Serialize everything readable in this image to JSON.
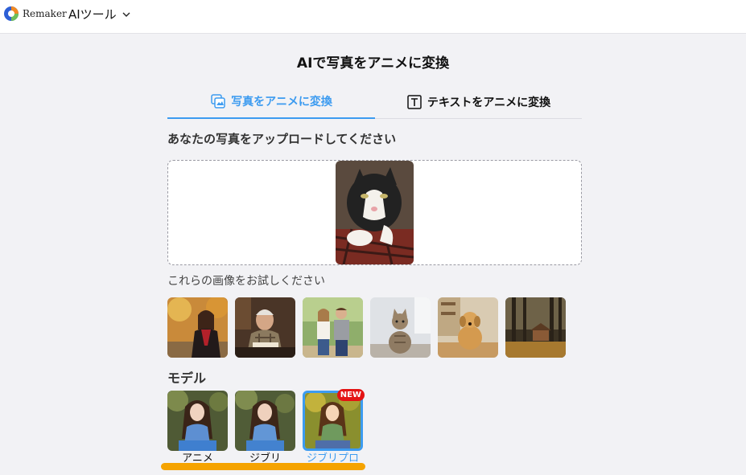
{
  "header": {
    "brand": "Remaker",
    "tools_label": "AIツール"
  },
  "page": {
    "title": "AIで写真をアニメに変換"
  },
  "tabs": [
    {
      "label": "写真をアニメに変換",
      "active": true
    },
    {
      "label": "テキストをアニメに変換",
      "active": false
    }
  ],
  "upload": {
    "heading": "あなたの写真をアップロードしてください"
  },
  "samples": {
    "label": "これらの画像をお試しください",
    "items": [
      "woman-autumn",
      "old-man-reading",
      "couple",
      "cat",
      "dog",
      "forest-cabin"
    ]
  },
  "models": {
    "heading": "モデル",
    "items": [
      {
        "label": "アニメ",
        "selected": false,
        "badge": ""
      },
      {
        "label": "ジブリ",
        "selected": false,
        "badge": ""
      },
      {
        "label": "ジブリプロ",
        "selected": true,
        "badge": "NEW"
      }
    ]
  },
  "colors": {
    "accent": "#3c9bf0",
    "badge": "#e41313",
    "highlight": "#f5a300",
    "background": "#f2f2f5"
  }
}
